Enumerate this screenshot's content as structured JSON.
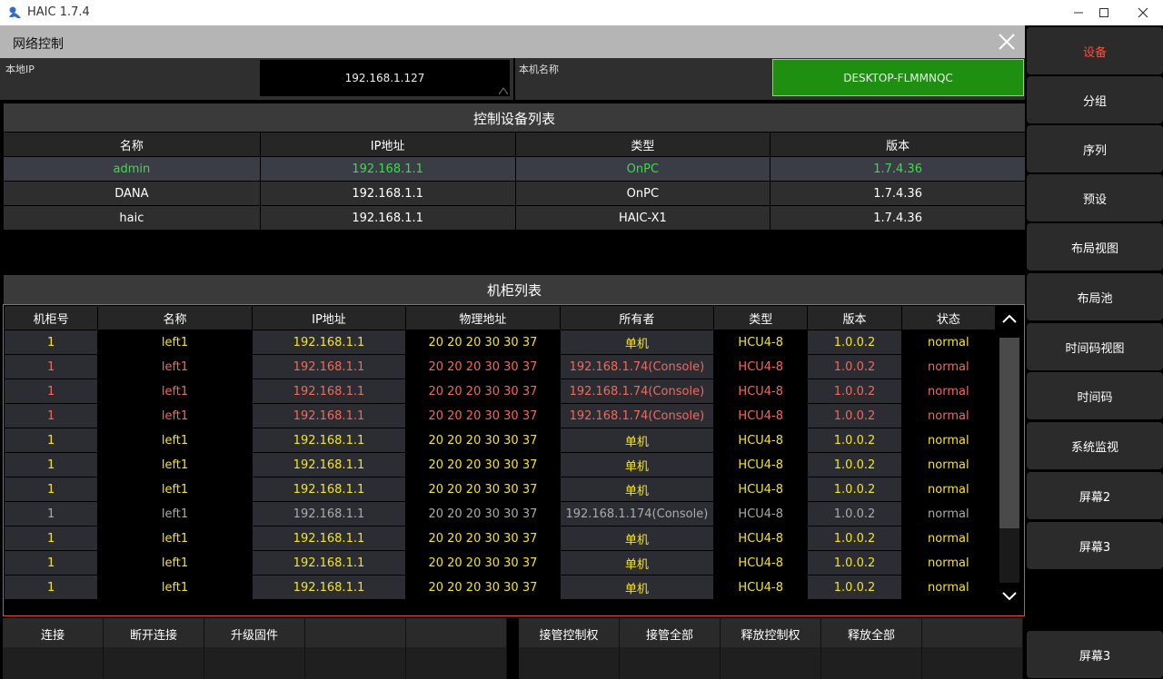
{
  "window": {
    "title": "HAIC 1.7.4"
  },
  "panel": {
    "title": "网络控制"
  },
  "local": {
    "ip_label": "本地IP",
    "ip_value": "192.168.1.127",
    "name_label": "本机名称",
    "name_value": "DESKTOP-FLMMNQC"
  },
  "control_devices": {
    "title": "控制设备列表",
    "columns": [
      "名称",
      "IP地址",
      "类型",
      "版本"
    ],
    "rows": [
      [
        "admin",
        "192.168.1.1",
        "OnPC",
        "1.7.4.36"
      ],
      [
        "DANA",
        "192.168.1.1",
        "OnPC",
        "1.7.4.36"
      ],
      [
        "haic",
        "192.168.1.1",
        "HAIC-X1",
        "1.7.4.36"
      ]
    ]
  },
  "cabinets": {
    "title": "机柜列表",
    "columns": [
      "机柜号",
      "名称",
      "IP地址",
      "物理地址",
      "所有者",
      "类型",
      "版本",
      "状态"
    ],
    "rows": [
      [
        "1",
        "left1",
        "192.168.1.1",
        "20 20 20 30 30 37",
        "单机",
        "HCU4-8",
        "1.0.0.2",
        "normal"
      ],
      [
        "1",
        "left1",
        "192.168.1.1",
        "20 20 20 30 30 37",
        "192.168.1.74(Console)",
        "HCU4-8",
        "1.0.0.2",
        "normal"
      ],
      [
        "1",
        "left1",
        "192.168.1.1",
        "20 20 20 30 30 37",
        "192.168.1.74(Console)",
        "HCU4-8",
        "1.0.0.2",
        "normal"
      ],
      [
        "1",
        "left1",
        "192.168.1.1",
        "20 20 20 30 30 37",
        "192.168.1.74(Console)",
        "HCU4-8",
        "1.0.0.2",
        "normal"
      ],
      [
        "1",
        "left1",
        "192.168.1.1",
        "20 20 20 30 30 37",
        "单机",
        "HCU4-8",
        "1.0.0.2",
        "normal"
      ],
      [
        "1",
        "left1",
        "192.168.1.1",
        "20 20 20 30 30 37",
        "单机",
        "HCU4-8",
        "1.0.0.2",
        "normal"
      ],
      [
        "1",
        "left1",
        "192.168.1.1",
        "20 20 20 30 30 37",
        "单机",
        "HCU4-8",
        "1.0.0.2",
        "normal"
      ],
      [
        "1",
        "left1",
        "192.168.1.1",
        "20 20 20 30 30 37",
        "192.168.1.174(Console)",
        "HCU4-8",
        "1.0.0.2",
        "normal"
      ],
      [
        "1",
        "left1",
        "192.168.1.1",
        "20 20 20 30 30 37",
        "单机",
        "HCU4-8",
        "1.0.0.2",
        "normal"
      ],
      [
        "1",
        "left1",
        "192.168.1.1",
        "20 20 20 30 30 37",
        "单机",
        "HCU4-8",
        "1.0.0.2",
        "normal"
      ],
      [
        "1",
        "left1",
        "192.168.1.1",
        "20 20 20 30 30 37",
        "单机",
        "HCU4-8",
        "1.0.0.2",
        "normal"
      ]
    ],
    "row_colors": [
      "yellow",
      "red",
      "red",
      "red",
      "yellow",
      "yellow",
      "yellow",
      "gray",
      "yellow",
      "yellow",
      "yellow"
    ]
  },
  "bottom_buttons_left": [
    "连接",
    "断开连接",
    "升级固件",
    "",
    ""
  ],
  "bottom_buttons_right": [
    "接管控制权",
    "接管全部",
    "释放控制权",
    "释放全部",
    ""
  ],
  "sidebar": {
    "items": [
      "设备",
      "分组",
      "序列",
      "预设",
      "布局视图",
      "布局池",
      "时间码视图",
      "时间码",
      "系统监视",
      "屏幕2",
      "屏幕3"
    ],
    "bottom_item": "屏幕3",
    "active_index": 0
  },
  "colors": {
    "accent_active": "#ff4e3a",
    "online_green": "#3ddc48",
    "host_bg": "#1f8f12",
    "yellow": "#f3e32b",
    "red": "#ee6a5d"
  }
}
